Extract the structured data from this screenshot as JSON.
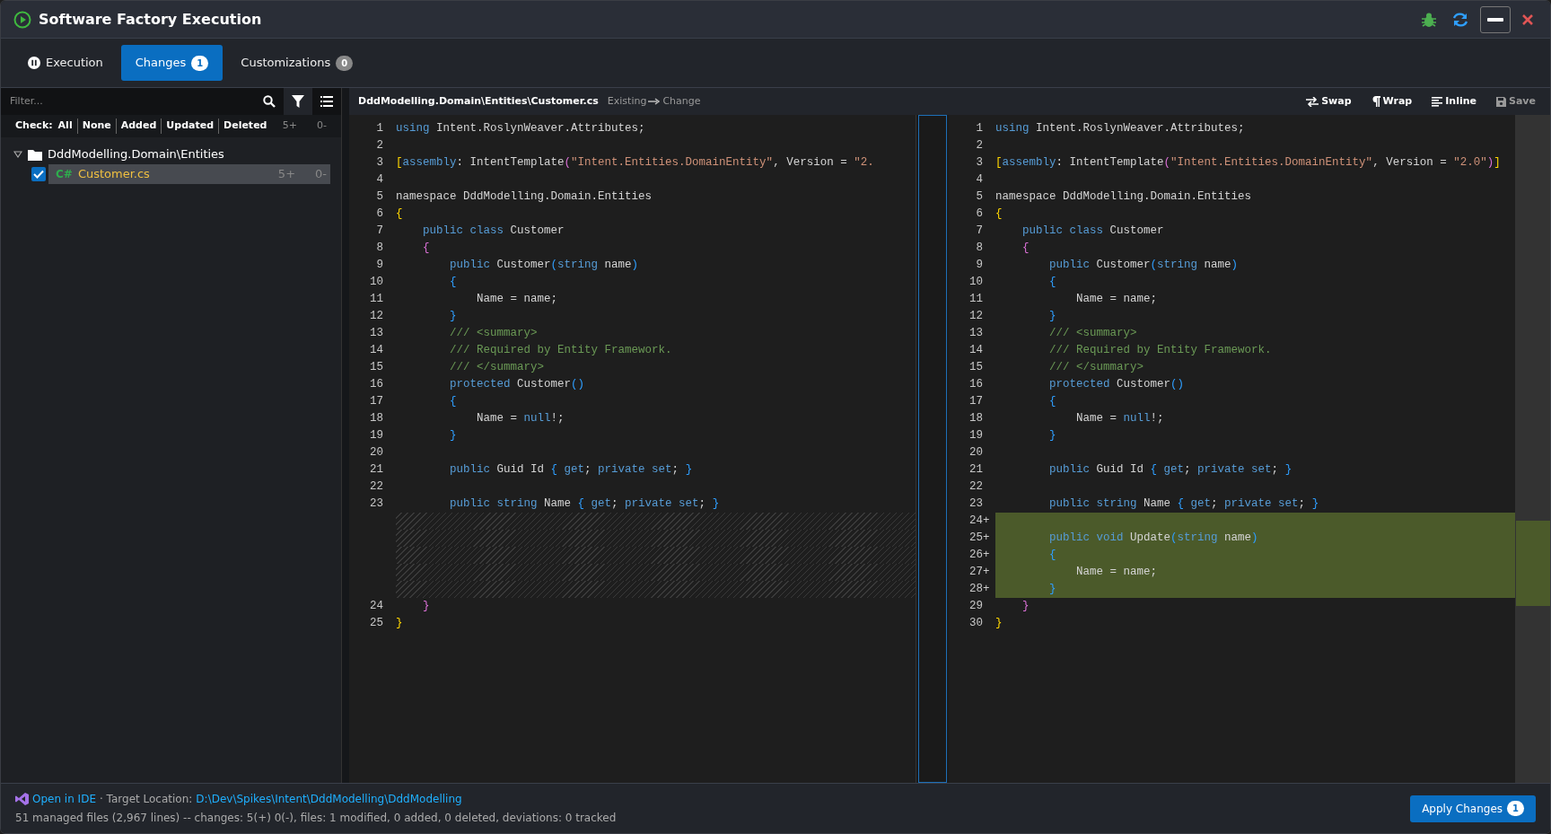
{
  "window": {
    "title": "Software Factory Execution"
  },
  "tabs": [
    {
      "label": "Execution",
      "selected": false
    },
    {
      "label": "Changes",
      "badge": "1",
      "selected": true
    },
    {
      "label": "Customizations",
      "badge": "0",
      "selected": false
    }
  ],
  "sidebar": {
    "filter": {
      "placeholder": "Filter..."
    },
    "check": {
      "label": "Check:",
      "options": [
        "All",
        "None",
        "Added",
        "Updated",
        "Deleted"
      ],
      "added": "5+",
      "removed": "0-"
    },
    "tree": [
      {
        "label": "DddModelling.Domain\\Entities",
        "expanded": true,
        "children": [
          {
            "label": "Customer.cs",
            "lang": "C#",
            "checked": true,
            "selected": true,
            "added": "5+",
            "removed": "0-"
          }
        ]
      }
    ]
  },
  "diff": {
    "path": "DddModelling.Domain\\Entities\\Customer.cs",
    "from": "Existing",
    "to": "Change",
    "actions": [
      {
        "label": "Swap",
        "disabled": false
      },
      {
        "label": "Wrap",
        "disabled": false
      },
      {
        "label": "Inline",
        "disabled": false
      },
      {
        "label": "Save",
        "disabled": true
      }
    ],
    "left": [
      {
        "num": "1",
        "tokens": [
          {
            "text": "using",
            "kind": "kw"
          },
          {
            "text": " Intent.RoslynWeaver.Attributes;",
            "kind": "p"
          }
        ]
      },
      {
        "num": "2"
      },
      {
        "num": "3",
        "tokens": [
          {
            "text": "[",
            "kind": "y"
          },
          {
            "text": "assembly",
            "kind": "kw"
          },
          {
            "text": ": IntentTemplate",
            "kind": "p"
          },
          {
            "text": "(",
            "kind": "m"
          },
          {
            "text": "\"Intent.Entities.DomainEntity\"",
            "kind": "s"
          },
          {
            "text": ", Version = ",
            "kind": "p"
          },
          {
            "text": "\"2.",
            "kind": "s"
          }
        ]
      },
      {
        "num": "4"
      },
      {
        "num": "5",
        "tokens": [
          {
            "text": "namespace DddModelling.Domain.Entities",
            "kind": "p"
          }
        ]
      },
      {
        "num": "6",
        "tokens": [
          {
            "text": "{",
            "kind": "y"
          }
        ]
      },
      {
        "num": "7",
        "tokens": [
          {
            "text": "    public class",
            "kind": "kw"
          },
          {
            "text": " Customer",
            "kind": "p"
          }
        ]
      },
      {
        "num": "8",
        "tokens": [
          {
            "text": "    {",
            "kind": "m"
          }
        ]
      },
      {
        "num": "9",
        "tokens": [
          {
            "text": "        public",
            "kind": "kw"
          },
          {
            "text": " Customer",
            "kind": "p"
          },
          {
            "text": "(",
            "kind": "b"
          },
          {
            "text": "string",
            "kind": "kw"
          },
          {
            "text": " name",
            "kind": "p"
          },
          {
            "text": ")",
            "kind": "b"
          }
        ]
      },
      {
        "num": "10",
        "tokens": [
          {
            "text": "        {",
            "kind": "b"
          }
        ]
      },
      {
        "num": "11",
        "tokens": [
          {
            "text": "            Name = name;",
            "kind": "p"
          }
        ]
      },
      {
        "num": "12",
        "tokens": [
          {
            "text": "        }",
            "kind": "b"
          }
        ]
      },
      {
        "num": "13",
        "tokens": [
          {
            "text": "        /// <summary>",
            "kind": "c"
          }
        ]
      },
      {
        "num": "14",
        "tokens": [
          {
            "text": "        /// Required by Entity Framework.",
            "kind": "c"
          }
        ]
      },
      {
        "num": "15",
        "tokens": [
          {
            "text": "        /// </summary>",
            "kind": "c"
          }
        ]
      },
      {
        "num": "16",
        "tokens": [
          {
            "text": "        protected",
            "kind": "kw"
          },
          {
            "text": " Customer",
            "kind": "p"
          },
          {
            "text": "()",
            "kind": "b"
          }
        ]
      },
      {
        "num": "17",
        "tokens": [
          {
            "text": "        {",
            "kind": "b"
          }
        ]
      },
      {
        "num": "18",
        "tokens": [
          {
            "text": "            Name = ",
            "kind": "p"
          },
          {
            "text": "null",
            "kind": "kw"
          },
          {
            "text": "!;",
            "kind": "p"
          }
        ]
      },
      {
        "num": "19",
        "tokens": [
          {
            "text": "        }",
            "kind": "b"
          }
        ]
      },
      {
        "num": "20"
      },
      {
        "num": "21",
        "tokens": [
          {
            "text": "        public",
            "kind": "kw"
          },
          {
            "text": " Guid Id ",
            "kind": "p"
          },
          {
            "text": "{",
            "kind": "b"
          },
          {
            "text": " get",
            "kind": "kw"
          },
          {
            "text": "; ",
            "kind": "p"
          },
          {
            "text": "private set",
            "kind": "kw"
          },
          {
            "text": "; ",
            "kind": "p"
          },
          {
            "text": "}",
            "kind": "b"
          }
        ]
      },
      {
        "num": "22"
      },
      {
        "num": "23",
        "tokens": [
          {
            "text": "        public string",
            "kind": "kw"
          },
          {
            "text": " Name ",
            "kind": "p"
          },
          {
            "text": "{",
            "kind": "b"
          },
          {
            "text": " get",
            "kind": "kw"
          },
          {
            "text": "; ",
            "kind": "p"
          },
          {
            "text": "private set",
            "kind": "kw"
          },
          {
            "text": "; ",
            "kind": "p"
          },
          {
            "text": "}",
            "kind": "b"
          }
        ]
      },
      {
        "kind": "filler"
      },
      {
        "kind": "filler"
      },
      {
        "kind": "filler"
      },
      {
        "kind": "filler"
      },
      {
        "kind": "filler"
      },
      {
        "num": "24",
        "tokens": [
          {
            "text": "    }",
            "kind": "m"
          }
        ]
      },
      {
        "num": "25",
        "tokens": [
          {
            "text": "}",
            "kind": "y"
          }
        ]
      }
    ],
    "right": [
      {
        "num": "1",
        "tokens": [
          {
            "text": "using",
            "kind": "kw"
          },
          {
            "text": " Intent.RoslynWeaver.Attributes;",
            "kind": "p"
          }
        ]
      },
      {
        "num": "2"
      },
      {
        "num": "3",
        "tokens": [
          {
            "text": "[",
            "kind": "y"
          },
          {
            "text": "assembly",
            "kind": "kw"
          },
          {
            "text": ": IntentTemplate",
            "kind": "p"
          },
          {
            "text": "(",
            "kind": "m"
          },
          {
            "text": "\"Intent.Entities.DomainEntity\"",
            "kind": "s"
          },
          {
            "text": ", Version = ",
            "kind": "p"
          },
          {
            "text": "\"2.0\"",
            "kind": "s"
          },
          {
            "text": ")",
            "kind": "m"
          },
          {
            "text": "]",
            "kind": "y"
          }
        ]
      },
      {
        "num": "4"
      },
      {
        "num": "5",
        "tokens": [
          {
            "text": "namespace DddModelling.Domain.Entities",
            "kind": "p"
          }
        ]
      },
      {
        "num": "6",
        "tokens": [
          {
            "text": "{",
            "kind": "y"
          }
        ]
      },
      {
        "num": "7",
        "tokens": [
          {
            "text": "    public class",
            "kind": "kw"
          },
          {
            "text": " Customer",
            "kind": "p"
          }
        ]
      },
      {
        "num": "8",
        "tokens": [
          {
            "text": "    {",
            "kind": "m"
          }
        ]
      },
      {
        "num": "9",
        "tokens": [
          {
            "text": "        public",
            "kind": "kw"
          },
          {
            "text": " Customer",
            "kind": "p"
          },
          {
            "text": "(",
            "kind": "b"
          },
          {
            "text": "string",
            "kind": "kw"
          },
          {
            "text": " name",
            "kind": "p"
          },
          {
            "text": ")",
            "kind": "b"
          }
        ]
      },
      {
        "num": "10",
        "tokens": [
          {
            "text": "        {",
            "kind": "b"
          }
        ]
      },
      {
        "num": "11",
        "tokens": [
          {
            "text": "            Name = name;",
            "kind": "p"
          }
        ]
      },
      {
        "num": "12",
        "tokens": [
          {
            "text": "        }",
            "kind": "b"
          }
        ]
      },
      {
        "num": "13",
        "tokens": [
          {
            "text": "        /// <summary>",
            "kind": "c"
          }
        ]
      },
      {
        "num": "14",
        "tokens": [
          {
            "text": "        /// Required by Entity Framework.",
            "kind": "c"
          }
        ]
      },
      {
        "num": "15",
        "tokens": [
          {
            "text": "        /// </summary>",
            "kind": "c"
          }
        ]
      },
      {
        "num": "16",
        "tokens": [
          {
            "text": "        protected",
            "kind": "kw"
          },
          {
            "text": " Customer",
            "kind": "p"
          },
          {
            "text": "()",
            "kind": "b"
          }
        ]
      },
      {
        "num": "17",
        "tokens": [
          {
            "text": "        {",
            "kind": "b"
          }
        ]
      },
      {
        "num": "18",
        "tokens": [
          {
            "text": "            Name = ",
            "kind": "p"
          },
          {
            "text": "null",
            "kind": "kw"
          },
          {
            "text": "!;",
            "kind": "p"
          }
        ]
      },
      {
        "num": "19",
        "tokens": [
          {
            "text": "        }",
            "kind": "b"
          }
        ]
      },
      {
        "num": "20"
      },
      {
        "num": "21",
        "tokens": [
          {
            "text": "        public",
            "kind": "kw"
          },
          {
            "text": " Guid Id ",
            "kind": "p"
          },
          {
            "text": "{",
            "kind": "b"
          },
          {
            "text": " get",
            "kind": "kw"
          },
          {
            "text": "; ",
            "kind": "p"
          },
          {
            "text": "private set",
            "kind": "kw"
          },
          {
            "text": "; ",
            "kind": "p"
          },
          {
            "text": "}",
            "kind": "b"
          }
        ]
      },
      {
        "num": "22"
      },
      {
        "num": "23",
        "tokens": [
          {
            "text": "        public string",
            "kind": "kw"
          },
          {
            "text": " Name ",
            "kind": "p"
          },
          {
            "text": "{",
            "kind": "b"
          },
          {
            "text": " get",
            "kind": "kw"
          },
          {
            "text": "; ",
            "kind": "p"
          },
          {
            "text": "private set",
            "kind": "kw"
          },
          {
            "text": "; ",
            "kind": "p"
          },
          {
            "text": "}",
            "kind": "b"
          }
        ]
      },
      {
        "num": "24",
        "kind": "added",
        "marker": "+"
      },
      {
        "num": "25",
        "kind": "added",
        "marker": "+",
        "tokens": [
          {
            "text": "        public void",
            "kind": "kw"
          },
          {
            "text": " Update",
            "kind": "p"
          },
          {
            "text": "(",
            "kind": "b"
          },
          {
            "text": "string",
            "kind": "kw"
          },
          {
            "text": " name",
            "kind": "p"
          },
          {
            "text": ")",
            "kind": "b"
          }
        ]
      },
      {
        "num": "26",
        "kind": "added",
        "marker": "+",
        "tokens": [
          {
            "text": "        {",
            "kind": "b"
          }
        ]
      },
      {
        "num": "27",
        "kind": "added",
        "marker": "+",
        "tokens": [
          {
            "text": "            Name = name;",
            "kind": "p"
          }
        ]
      },
      {
        "num": "28",
        "kind": "added",
        "marker": "+",
        "tokens": [
          {
            "text": "        }",
            "kind": "b"
          }
        ]
      },
      {
        "num": "29",
        "tokens": [
          {
            "text": "    }",
            "kind": "m"
          }
        ]
      },
      {
        "num": "30",
        "tokens": [
          {
            "text": "}",
            "kind": "y"
          }
        ]
      }
    ]
  },
  "status_bar": {
    "open_ide": "Open in IDE",
    "target_label": "· Target Location:",
    "target_path": "D:\\Dev\\Spikes\\Intent\\DddModelling\\DddModelling",
    "summary": "51 managed files (2,967 lines) -- changes: 5(+) 0(-), files: 1 modified, 0 added, 0 deleted, deviations: 0 tracked",
    "apply": {
      "label": "Apply Changes",
      "badge": "1"
    }
  }
}
